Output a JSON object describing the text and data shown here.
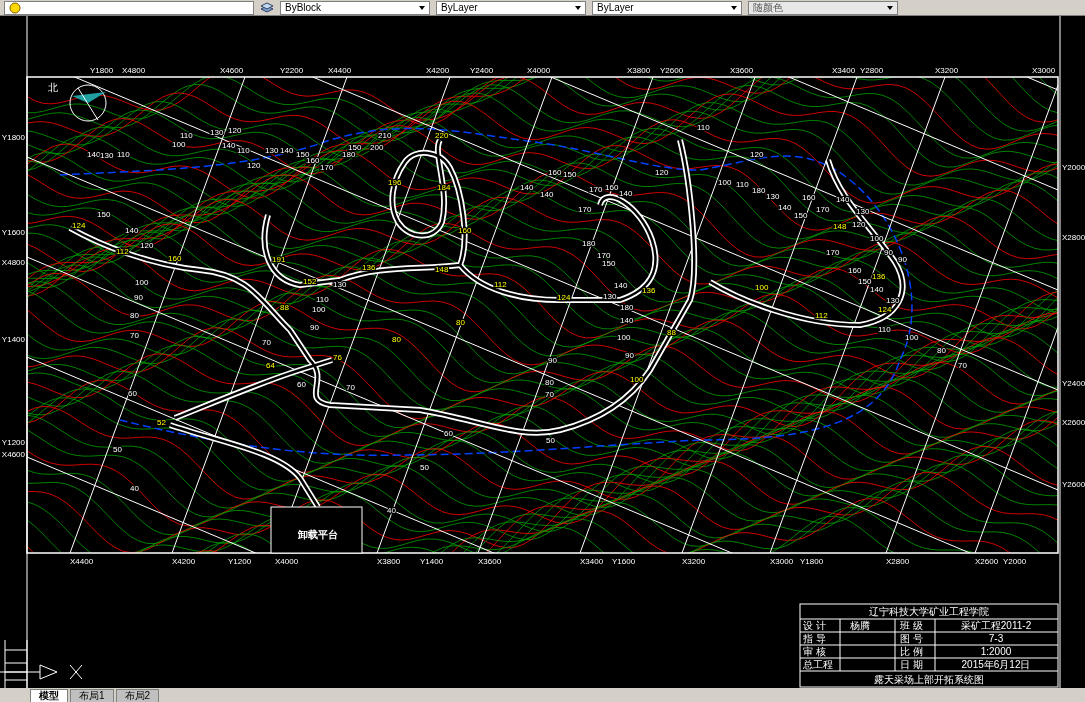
{
  "toolbar": {
    "dropdowns": [
      {
        "value": "ByBlock"
      },
      {
        "value": "ByLayer"
      },
      {
        "value": "ByLayer"
      },
      {
        "value": "随颜色"
      }
    ]
  },
  "drawing": {
    "north_label": "北",
    "platform_label": "卸载平台",
    "grid_labels": {
      "top": [
        "Y1800",
        "X4800",
        "X4600",
        "Y2200",
        "X4400",
        "X4200",
        "Y2400",
        "X4000",
        "X3800",
        "Y2600",
        "X3600",
        "X3400",
        "Y2800",
        "X3200",
        "X3000"
      ],
      "bottom": [
        "X4400",
        "X4200",
        "Y1200",
        "X4000",
        "X3800",
        "Y1400",
        "X3600",
        "X3400",
        "Y1600",
        "X3200",
        "X3000",
        "Y1800",
        "X2800",
        "X2600",
        "Y2000"
      ],
      "left": [
        "Y1800",
        "Y1600",
        "X4800",
        "Y1400",
        "Y1200",
        "X4600"
      ],
      "right": [
        "Y2000",
        "X2800",
        "Y2400",
        "X2600",
        "Y2600"
      ]
    },
    "elevation_labels": [
      {
        "text": "100",
        "kind": "contour"
      },
      {
        "text": "110",
        "kind": "contour"
      },
      {
        "text": "130",
        "kind": "contour"
      },
      {
        "text": "120",
        "kind": "contour"
      },
      {
        "text": "140",
        "kind": "contour"
      },
      {
        "text": "110",
        "kind": "contour"
      },
      {
        "text": "120",
        "kind": "contour"
      },
      {
        "text": "130",
        "kind": "contour"
      },
      {
        "text": "140",
        "kind": "contour"
      },
      {
        "text": "150",
        "kind": "contour"
      },
      {
        "text": "160",
        "kind": "contour"
      },
      {
        "text": "170",
        "kind": "contour"
      },
      {
        "text": "180",
        "kind": "contour"
      },
      {
        "text": "150",
        "kind": "contour"
      },
      {
        "text": "200",
        "kind": "contour"
      },
      {
        "text": "210",
        "kind": "contour"
      },
      {
        "text": "140",
        "kind": "contour"
      },
      {
        "text": "130",
        "kind": "contour"
      },
      {
        "text": "110",
        "kind": "contour"
      },
      {
        "text": "150",
        "kind": "contour"
      },
      {
        "text": "140",
        "kind": "contour"
      },
      {
        "text": "120",
        "kind": "contour"
      },
      {
        "text": "100",
        "kind": "contour"
      },
      {
        "text": "90",
        "kind": "contour"
      },
      {
        "text": "80",
        "kind": "contour"
      },
      {
        "text": "70",
        "kind": "contour"
      },
      {
        "text": "60",
        "kind": "contour"
      },
      {
        "text": "50",
        "kind": "contour"
      },
      {
        "text": "40",
        "kind": "contour"
      },
      {
        "text": "130",
        "kind": "contour"
      },
      {
        "text": "110",
        "kind": "contour"
      },
      {
        "text": "100",
        "kind": "contour"
      },
      {
        "text": "90",
        "kind": "contour"
      },
      {
        "text": "70",
        "kind": "contour"
      },
      {
        "text": "60",
        "kind": "contour"
      },
      {
        "text": "70",
        "kind": "contour"
      },
      {
        "text": "170",
        "kind": "contour"
      },
      {
        "text": "180",
        "kind": "contour"
      },
      {
        "text": "170",
        "kind": "contour"
      },
      {
        "text": "150",
        "kind": "contour"
      },
      {
        "text": "140",
        "kind": "contour"
      },
      {
        "text": "130",
        "kind": "contour"
      },
      {
        "text": "140",
        "kind": "contour"
      },
      {
        "text": "160",
        "kind": "contour"
      },
      {
        "text": "170",
        "kind": "contour"
      },
      {
        "text": "150",
        "kind": "contour"
      },
      {
        "text": "160",
        "kind": "contour"
      },
      {
        "text": "140",
        "kind": "contour"
      },
      {
        "text": "140",
        "kind": "contour"
      },
      {
        "text": "180",
        "kind": "contour"
      },
      {
        "text": "140",
        "kind": "contour"
      },
      {
        "text": "100",
        "kind": "contour"
      },
      {
        "text": "90",
        "kind": "contour"
      },
      {
        "text": "90",
        "kind": "contour"
      },
      {
        "text": "80",
        "kind": "contour"
      },
      {
        "text": "70",
        "kind": "contour"
      },
      {
        "text": "60",
        "kind": "contour"
      },
      {
        "text": "50",
        "kind": "contour"
      },
      {
        "text": "50",
        "kind": "contour"
      },
      {
        "text": "40",
        "kind": "contour"
      },
      {
        "text": "120",
        "kind": "contour"
      },
      {
        "text": "110",
        "kind": "contour"
      },
      {
        "text": "120",
        "kind": "contour"
      },
      {
        "text": "100",
        "kind": "contour"
      },
      {
        "text": "110",
        "kind": "contour"
      },
      {
        "text": "180",
        "kind": "contour"
      },
      {
        "text": "130",
        "kind": "contour"
      },
      {
        "text": "140",
        "kind": "contour"
      },
      {
        "text": "150",
        "kind": "contour"
      },
      {
        "text": "160",
        "kind": "contour"
      },
      {
        "text": "170",
        "kind": "contour"
      },
      {
        "text": "140",
        "kind": "contour"
      },
      {
        "text": "130",
        "kind": "contour"
      },
      {
        "text": "120",
        "kind": "contour"
      },
      {
        "text": "100",
        "kind": "contour"
      },
      {
        "text": "90",
        "kind": "contour"
      },
      {
        "text": "90",
        "kind": "contour"
      },
      {
        "text": "170",
        "kind": "contour"
      },
      {
        "text": "160",
        "kind": "contour"
      },
      {
        "text": "150",
        "kind": "contour"
      },
      {
        "text": "140",
        "kind": "contour"
      },
      {
        "text": "130",
        "kind": "contour"
      },
      {
        "text": "110",
        "kind": "contour"
      },
      {
        "text": "100",
        "kind": "contour"
      },
      {
        "text": "80",
        "kind": "contour"
      },
      {
        "text": "70",
        "kind": "contour"
      },
      {
        "text": "124",
        "kind": "road"
      },
      {
        "text": "112",
        "kind": "road"
      },
      {
        "text": "160",
        "kind": "road"
      },
      {
        "text": "191",
        "kind": "road"
      },
      {
        "text": "152",
        "kind": "road"
      },
      {
        "text": "136",
        "kind": "road"
      },
      {
        "text": "148",
        "kind": "road"
      },
      {
        "text": "160",
        "kind": "road"
      },
      {
        "text": "184",
        "kind": "road"
      },
      {
        "text": "196",
        "kind": "road"
      },
      {
        "text": "220",
        "kind": "road"
      },
      {
        "text": "112",
        "kind": "road"
      },
      {
        "text": "124",
        "kind": "road"
      },
      {
        "text": "136",
        "kind": "road"
      },
      {
        "text": "100",
        "kind": "road"
      },
      {
        "text": "112",
        "kind": "road"
      },
      {
        "text": "124",
        "kind": "road"
      },
      {
        "text": "136",
        "kind": "road"
      },
      {
        "text": "148",
        "kind": "road"
      },
      {
        "text": "88",
        "kind": "road"
      },
      {
        "text": "76",
        "kind": "road"
      },
      {
        "text": "64",
        "kind": "road"
      },
      {
        "text": "52",
        "kind": "road"
      },
      {
        "text": "100",
        "kind": "road"
      },
      {
        "text": "88",
        "kind": "road"
      },
      {
        "text": "80",
        "kind": "road"
      },
      {
        "text": "80",
        "kind": "road"
      }
    ]
  },
  "title_block": {
    "title": "辽宁科技大学矿业工程学院",
    "rows": [
      {
        "label": "设 计",
        "value": "杨腾",
        "label_2": "班 级",
        "value_2": "采矿工程2011-2"
      },
      {
        "label": "指 导",
        "value": "",
        "label_2": "图 号",
        "value_2": "7-3"
      },
      {
        "label": "审 核",
        "value": "",
        "label_2": "比 例",
        "value_2": "1:2000"
      },
      {
        "label": "总工程",
        "value": "",
        "label_2": "日 期",
        "value_2": "2015年6月12日"
      }
    ],
    "drawing_name": "露天采场上部开拓系统图"
  },
  "tabs": [
    {
      "label": "模型",
      "selected": true
    },
    {
      "label": "布局1",
      "selected": false
    },
    {
      "label": "布局2",
      "selected": false
    }
  ]
}
